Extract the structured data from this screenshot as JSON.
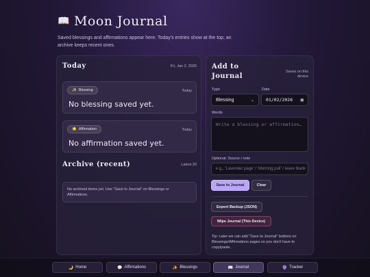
{
  "app": {
    "title": "Moon Journal",
    "book_glyph": "📖",
    "subtitle": "Saved blessings and affirmations appear here. Today's entries show at the top; an archive keeps recent ones."
  },
  "today": {
    "heading": "Today",
    "date": "Fri, Jan 2, 2026",
    "blessing": {
      "icon": "✨",
      "label": "Blessing",
      "day": "Today",
      "text": "No blessing saved yet."
    },
    "affirmation": {
      "icon": "🌟",
      "label": "Affirmation",
      "day": "Today",
      "text": "No affirmation saved yet."
    }
  },
  "archive": {
    "heading": "Archive (recent)",
    "latest": "Latest 20",
    "empty": "No archived items yet. Use \"Save to Journal\" on Blessings or Affirmations."
  },
  "add": {
    "heading": "Add to Journal",
    "saves_note": "Saves on this device",
    "type_label": "Type",
    "type_value": "Blessing",
    "date_label": "Date",
    "date_value": "01/02/2026",
    "words_label": "Words",
    "words_placeholder": "Write a blessing or affirmation…",
    "source_label": "Optional: Source / note",
    "source_placeholder": "e.g., 'Lavender page' / 'Morning pull' / leave blank",
    "save_button": "Save to Journal",
    "clear_button": "Clear",
    "export_button": "Export Backup (JSON)",
    "wipe_button": "Wipe Journal (This Device)",
    "tip": "Tip: Later we can add \"Save to Journal\" buttons on Blessings/Affirmations pages so you don't have to copy/paste."
  },
  "nav": [
    {
      "icon": "🌙",
      "label": "Home"
    },
    {
      "icon": "💬",
      "label": "Affirmations"
    },
    {
      "icon": "✨",
      "label": "Blessings"
    },
    {
      "icon": "📖",
      "label": "Journal"
    },
    {
      "icon": "🔮",
      "label": "Tracker"
    }
  ],
  "nav_active": "Journal",
  "icons": {
    "calendar": "calendar-icon",
    "dropdown": "chevron-down-icon"
  },
  "colors": {
    "accent": "#b9a6f5",
    "background": "#221838"
  }
}
